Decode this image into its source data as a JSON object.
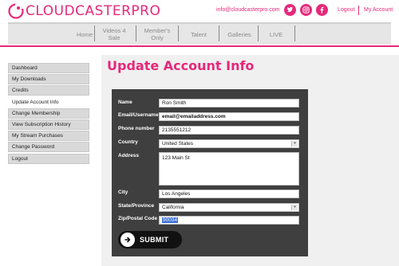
{
  "header": {
    "logo_text_main": "CLOUDCASTER",
    "logo_text_suffix": "PRO",
    "email": "info@cloudcasterpro.com",
    "social": [
      {
        "name": "twitter",
        "glyph": "t"
      },
      {
        "name": "instagram",
        "glyph": "◎"
      },
      {
        "name": "facebook",
        "glyph": "f"
      }
    ],
    "logout_label": "Logout",
    "my_account_label": "My Account",
    "brand_color": "#e6287a"
  },
  "nav": {
    "items": [
      {
        "label": "Home"
      },
      {
        "label": "Videos 4 Sale"
      },
      {
        "label": "Member's Only"
      },
      {
        "label": "Talent"
      },
      {
        "label": "Galleries"
      },
      {
        "label": "LIVE"
      }
    ]
  },
  "sidebar": {
    "items": [
      {
        "label": "Dashboard",
        "active": false
      },
      {
        "label": "My Downloads",
        "active": false
      },
      {
        "label": "Credits",
        "active": false
      },
      {
        "label": "Update Account Info",
        "active": true
      },
      {
        "label": "Change Membership",
        "active": false
      },
      {
        "label": "View Subscription History",
        "active": false
      },
      {
        "label": "My Stream Purchases",
        "active": false
      },
      {
        "label": "Change Password",
        "active": false
      },
      {
        "label": "Logout",
        "active": false
      }
    ]
  },
  "main": {
    "title": "Update Account Info",
    "form": {
      "name": {
        "label": "Name",
        "value": "Ron Smith"
      },
      "email": {
        "label": "Email/Username",
        "value": "email@emailaddress.com"
      },
      "phone": {
        "label": "Phone number",
        "value": "2135551212"
      },
      "country": {
        "label": "Country",
        "value": "United States"
      },
      "address": {
        "label": "Address",
        "value": "123 Main St"
      },
      "city": {
        "label": "City",
        "value": "Los Angeles"
      },
      "state": {
        "label": "State/Province",
        "value": "California"
      },
      "zip": {
        "label": "Zip/Postal Code",
        "value": "90034"
      }
    },
    "submit_label": "SUBMIT"
  }
}
